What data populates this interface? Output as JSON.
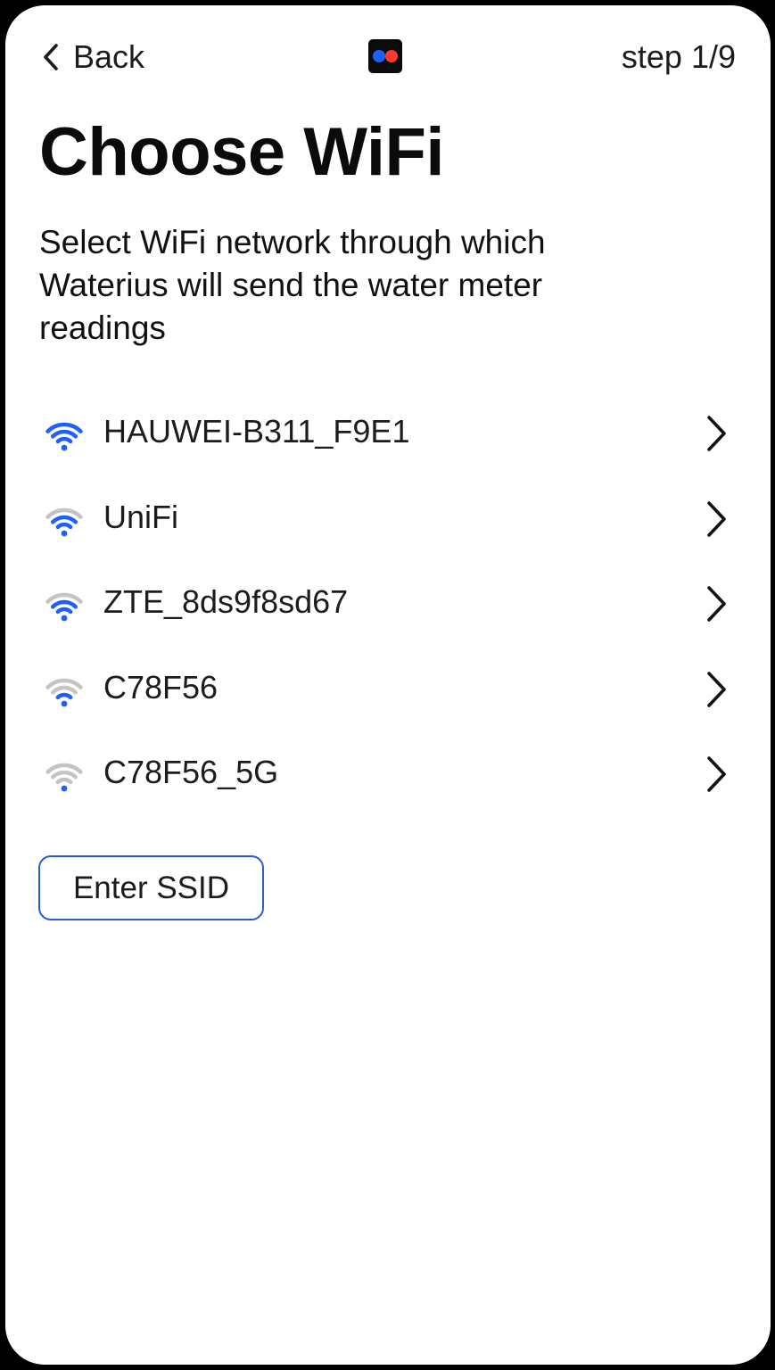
{
  "header": {
    "back_label": "Back",
    "step_label": "step 1/9",
    "logo_colors": {
      "blue": "#1f5fff",
      "red": "#ff3b30",
      "background": "#0b0b0b"
    }
  },
  "title": "Choose WiFi",
  "subtitle": "Select WiFi network through which Waterius will send the water meter readings",
  "networks": [
    {
      "name": "HAUWEI-B311_F9E1",
      "signal_bars": 4,
      "icon": "wifi-signal-icon"
    },
    {
      "name": "UniFi",
      "signal_bars": 3,
      "icon": "wifi-signal-icon"
    },
    {
      "name": "ZTE_8ds9f8sd67",
      "signal_bars": 3,
      "icon": "wifi-signal-icon"
    },
    {
      "name": "C78F56",
      "signal_bars": 2,
      "icon": "wifi-signal-icon"
    },
    {
      "name": "C78F56_5G",
      "signal_bars": 1,
      "icon": "wifi-signal-icon"
    }
  ],
  "enter_ssid_label": "Enter SSID",
  "colors": {
    "signal_active": "#1f5fff",
    "signal_inactive": "#c4c4c4",
    "accent_border": "#2a5bd7",
    "text": "#1c1c1c"
  }
}
